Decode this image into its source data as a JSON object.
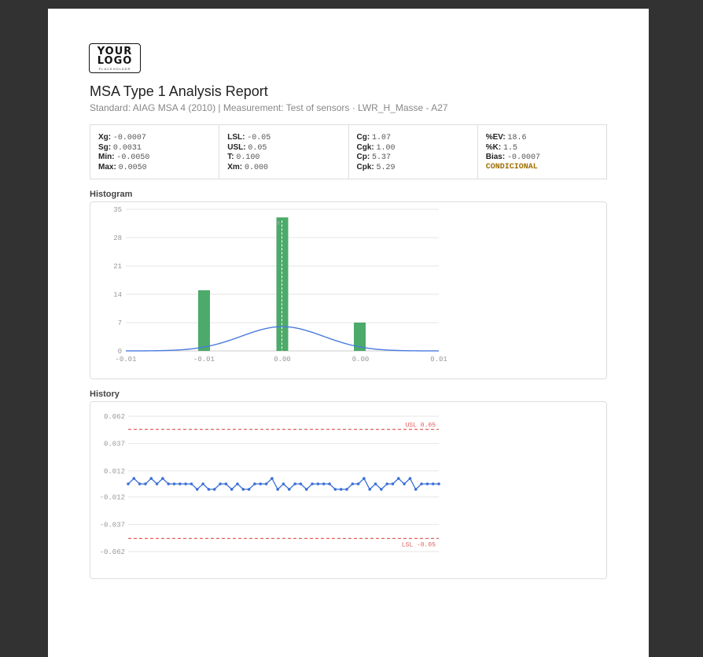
{
  "logo": {
    "line1": "YOUR",
    "line2": "LOGO",
    "line3": "PLACEHOLDER"
  },
  "report": {
    "title": "MSA Type 1 Analysis Report",
    "subtitle": "Standard: AIAG MSA 4 (2010) | Measurement: Test of sensors · LWR_H_Masse - A27"
  },
  "stats": {
    "c1": [
      {
        "k": "Xg:",
        "v": "-0.0007"
      },
      {
        "k": "Sg:",
        "v": "0.0031"
      },
      {
        "k": "Min:",
        "v": "-0.0050"
      },
      {
        "k": "Max:",
        "v": "0.0050"
      }
    ],
    "c2": [
      {
        "k": "LSL:",
        "v": "-0.05"
      },
      {
        "k": "USL:",
        "v": "0.05"
      },
      {
        "k": "T:",
        "v": "0.100"
      },
      {
        "k": "Xm:",
        "v": "0.000"
      }
    ],
    "c3": [
      {
        "k": "Cg:",
        "v": "1.07"
      },
      {
        "k": "Cgk:",
        "v": "1.00"
      },
      {
        "k": "Cp:",
        "v": "5.37"
      },
      {
        "k": "Cpk:",
        "v": "5.29"
      }
    ],
    "c4": [
      {
        "k": "%EV:",
        "v": "18.6"
      },
      {
        "k": "%K:",
        "v": "1.5"
      },
      {
        "k": "Bias:",
        "v": "-0.0007"
      }
    ],
    "verdict": "CONDICIONAL",
    "verdict_color": "#a07000"
  },
  "sections": {
    "histogram": "Histogram",
    "history": "History"
  },
  "chart_data": [
    {
      "type": "bar",
      "title": "Histogram",
      "y_ticks": [
        "0",
        "7",
        "14",
        "21",
        "28",
        "35"
      ],
      "ylim": [
        0,
        35
      ],
      "x_ticks": [
        "-0.01",
        "-0.01",
        "0.00",
        "0.00",
        "0.01"
      ],
      "bins": [
        "-0.005",
        "0.000",
        "0.005"
      ],
      "values": [
        15,
        33,
        7
      ],
      "bar_color": "#4caa6a",
      "curve_color": "#4a7be0",
      "mean_marker": "x",
      "grid": true
    },
    {
      "type": "line",
      "title": "History",
      "y_ticks": [
        "0.062",
        "0.037",
        "0.012",
        "-0.012",
        "-0.037",
        "-0.062"
      ],
      "ylim": [
        -0.062,
        0.062
      ],
      "usl": {
        "label": "USL 0.05",
        "value": 0.05
      },
      "lsl": {
        "label": "LSL -0.05",
        "value": -0.05
      },
      "limit_color": "#e06060",
      "line_color": "#3a6fd8",
      "values": [
        0.0,
        0.005,
        0.0,
        0.0,
        0.005,
        0.0,
        0.005,
        0.0,
        0.0,
        0.0,
        0.0,
        0.0,
        -0.005,
        0.0,
        -0.005,
        -0.005,
        0.0,
        0.0,
        -0.005,
        0.0,
        -0.005,
        -0.005,
        0.0,
        0.0,
        0.0,
        0.005,
        -0.005,
        0.0,
        -0.005,
        0.0,
        0.0,
        -0.005,
        0.0,
        0.0,
        0.0,
        0.0,
        -0.005,
        -0.005,
        -0.005,
        0.0,
        0.0,
        0.005,
        -0.005,
        0.0,
        -0.005,
        0.0,
        0.0,
        0.005,
        0.0,
        0.005,
        -0.005,
        0.0,
        0.0,
        0.0,
        0.0
      ]
    }
  ]
}
